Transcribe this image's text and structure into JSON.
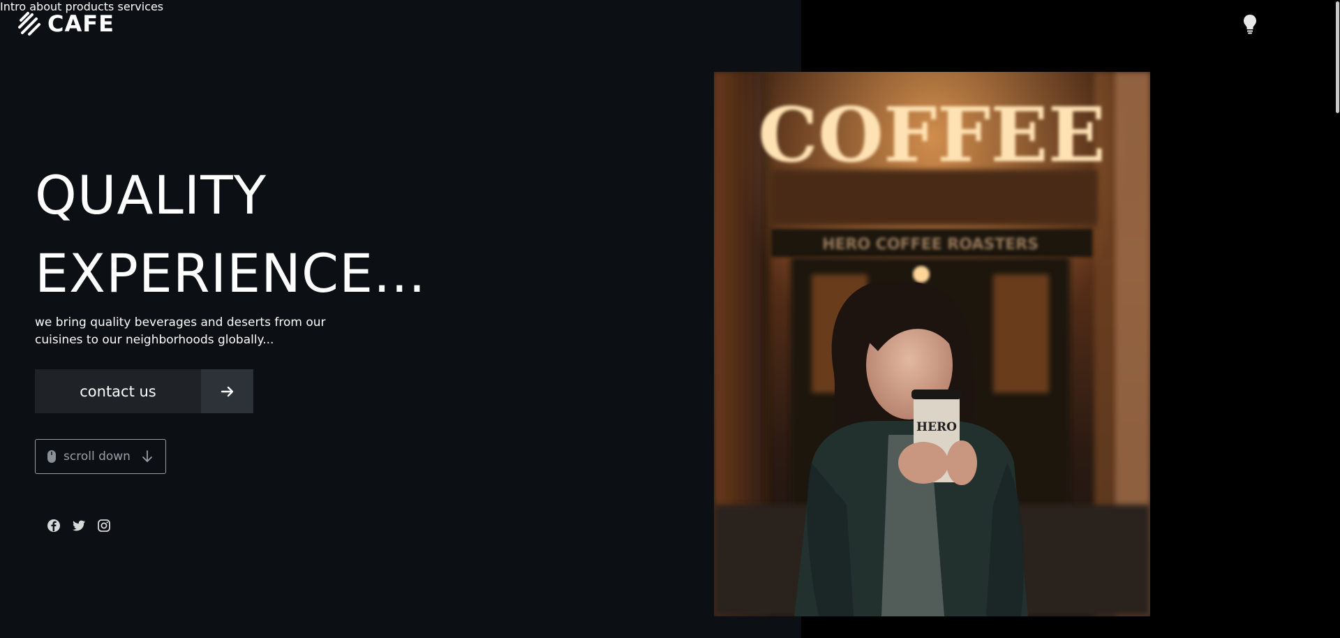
{
  "brand": {
    "name": "CAFE"
  },
  "nav": {
    "items": [
      {
        "label": "Intro"
      },
      {
        "label": "about"
      },
      {
        "label": "products"
      },
      {
        "label": "services"
      }
    ],
    "theme_toggle_icon": "lightbulb-icon"
  },
  "hero": {
    "title_line1": "QUALITY",
    "title_line2": "EXPERIENCE...",
    "subtitle": "we bring quality beverages and deserts from our cuisines to our neighborhoods globally...",
    "cta_label": "contact us",
    "cta_icon": "arrow-right-icon",
    "scroll_label": "scroll down",
    "scroll_icons": [
      "mouse-icon",
      "arrow-down-icon"
    ]
  },
  "social": {
    "icons": [
      "facebook-icon",
      "twitter-icon",
      "instagram-icon"
    ]
  },
  "image": {
    "sign_text": "COFFEE",
    "storefront_text": "HERO COFFEE ROASTERS",
    "cup_text": "HERO"
  },
  "colors": {
    "background": "#0c0f14",
    "right_panel": "#000000",
    "button": "#1f2328",
    "button_arrow": "#2d3238",
    "muted": "#9aa0a6"
  }
}
